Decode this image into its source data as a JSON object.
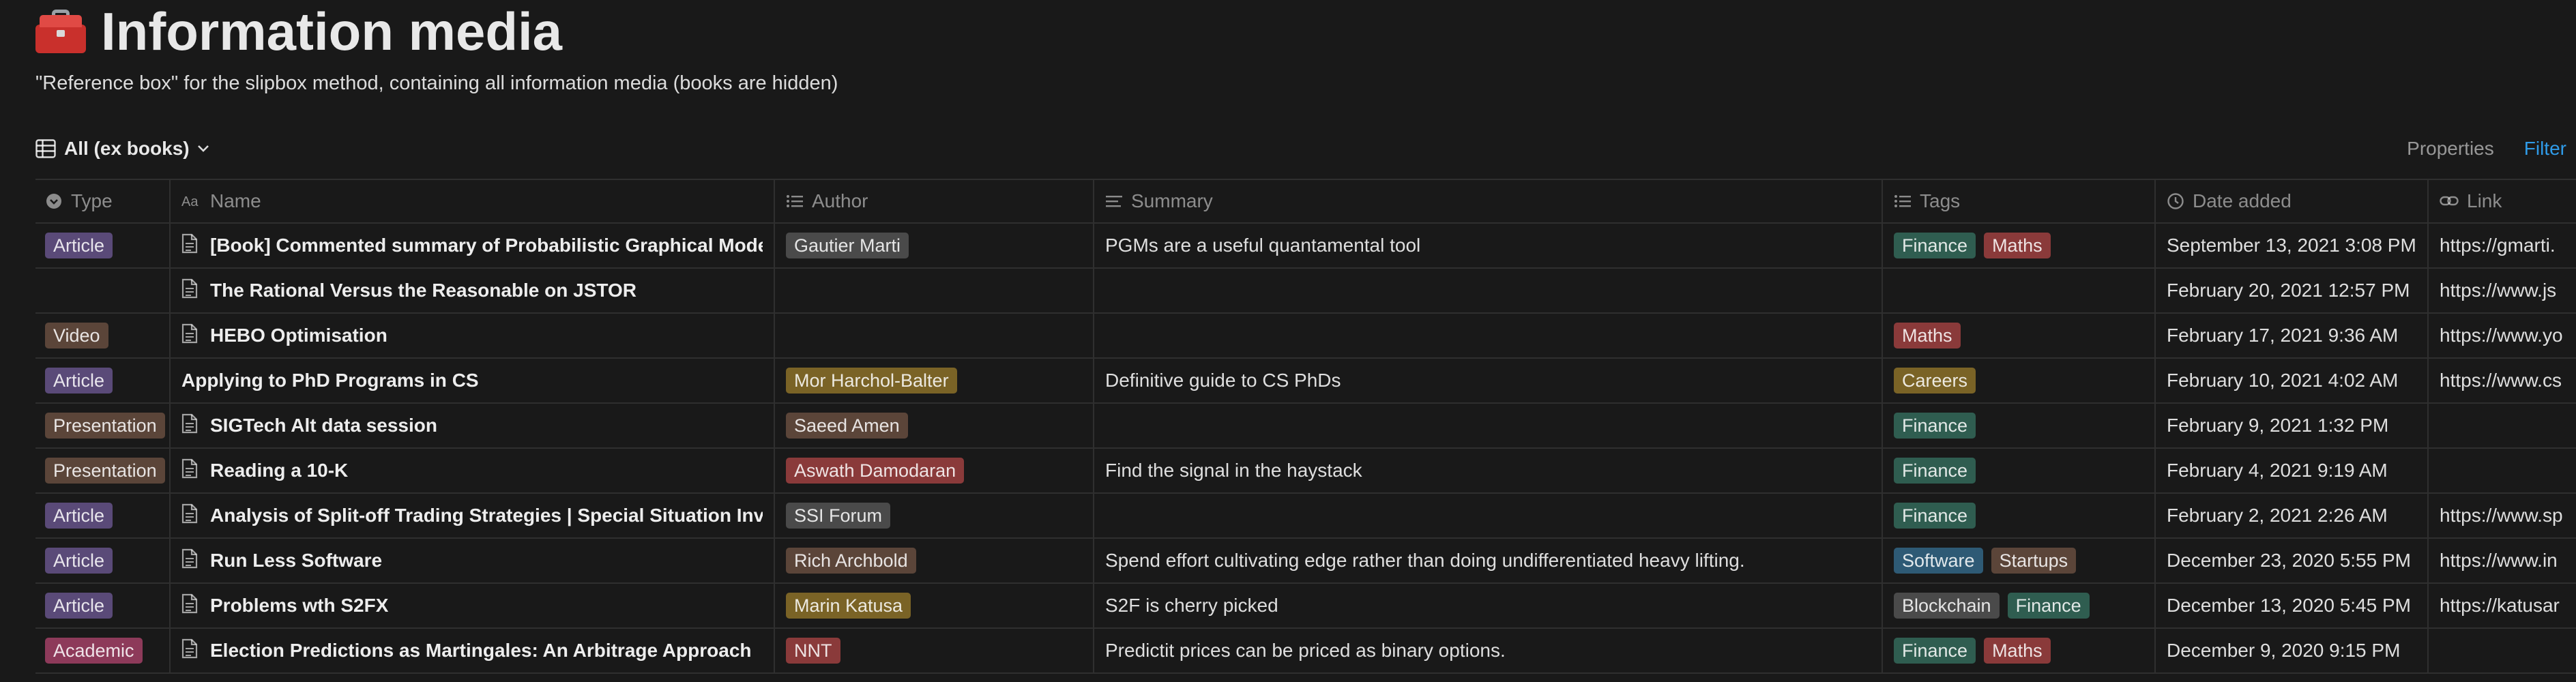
{
  "page": {
    "title": "Information media",
    "icon": "toolbox-icon",
    "description": "\"Reference box\" for the slipbox method, containing all information media (books are hidden)"
  },
  "view": {
    "name": "All (ex books)",
    "icon": "table-icon",
    "properties_label": "Properties",
    "filter_label": "Filter"
  },
  "columns": {
    "type": "Type",
    "name": "Name",
    "author": "Author",
    "summary": "Summary",
    "tags": "Tags",
    "date_added": "Date added",
    "link": "Link"
  },
  "colors": {
    "Article": "#5a4a78",
    "Video": "#5b4539",
    "Presentation": "#5b4539",
    "Academic": "#8d3a5a",
    "Finance": "#2f5d50",
    "Maths": "#8a3a3a",
    "Careers": "#7a6326",
    "Software": "#2e5a75",
    "Startups": "#5b4539",
    "Blockchain": "#4a4a4a",
    "Gautier Marti": "#4a4a4a",
    "Mor Harchol-Balter": "#7a6326",
    "Saeed Amen": "#5b4539",
    "Aswath Damodaran": "#8a3a3a",
    "SSI Forum": "#4a4a4a",
    "Rich Archbold": "#5b4539",
    "Marin Katusa": "#7a6326",
    "NNT": "#8a3a3a"
  },
  "rows": [
    {
      "type": "Article",
      "name": "[Book] Commented summary of Probabilistic Graphical Models",
      "has_doc_icon": true,
      "author": "Gautier Marti",
      "summary": "PGMs are a useful quantamental tool",
      "tags": [
        "Finance",
        "Maths"
      ],
      "date": "September 13, 2021 3:08 PM",
      "link": "https://gmarti."
    },
    {
      "type": "",
      "name": "The Rational Versus the Reasonable on JSTOR",
      "has_doc_icon": true,
      "author": "",
      "summary": "",
      "tags": [],
      "date": "February 20, 2021 12:57 PM",
      "link": "https://www.js"
    },
    {
      "type": "Video",
      "name": "HEBO Optimisation",
      "has_doc_icon": true,
      "author": "",
      "summary": "",
      "tags": [
        "Maths"
      ],
      "date": "February 17, 2021 9:36 AM",
      "link": "https://www.yo"
    },
    {
      "type": "Article",
      "name": "Applying to PhD Programs in CS",
      "has_doc_icon": false,
      "author": "Mor Harchol-Balter",
      "summary": "Definitive guide to CS PhDs",
      "tags": [
        "Careers"
      ],
      "date": "February 10, 2021 4:02 AM",
      "link": "https://www.cs"
    },
    {
      "type": "Presentation",
      "name": "SIGTech Alt data session",
      "has_doc_icon": true,
      "author": "Saeed Amen",
      "summary": "",
      "tags": [
        "Finance"
      ],
      "date": "February 9, 2021 1:32 PM",
      "link": ""
    },
    {
      "type": "Presentation",
      "name": "Reading a 10-K",
      "has_doc_icon": true,
      "author": "Aswath Damodaran",
      "summary": "Find the signal in the haystack",
      "tags": [
        "Finance"
      ],
      "date": "February 4, 2021 9:19 AM",
      "link": ""
    },
    {
      "type": "Article",
      "name": "Analysis of Split-off Trading Strategies | Special Situation Inves",
      "has_doc_icon": true,
      "author": "SSI Forum",
      "summary": "",
      "tags": [
        "Finance"
      ],
      "date": "February 2, 2021 2:26 AM",
      "link": "https://www.sp"
    },
    {
      "type": "Article",
      "name": "Run Less Software",
      "has_doc_icon": true,
      "author": "Rich Archbold",
      "summary": "Spend effort cultivating edge rather than doing undifferentiated heavy lifting.",
      "tags": [
        "Software",
        "Startups"
      ],
      "date": "December 23, 2020 5:55 PM",
      "link": "https://www.in"
    },
    {
      "type": "Article",
      "name": "Problems wth S2FX",
      "has_doc_icon": true,
      "author": "Marin Katusa",
      "summary": "S2F is cherry picked",
      "tags": [
        "Blockchain",
        "Finance"
      ],
      "date": "December 13, 2020 5:45 PM",
      "link": "https://katusar"
    },
    {
      "type": "Academic",
      "name": "Election Predictions as Martingales: An Arbitrage Approach",
      "has_doc_icon": true,
      "author": "NNT",
      "summary": "Predictit prices can be priced as binary options.",
      "tags": [
        "Finance",
        "Maths"
      ],
      "date": "December 9, 2020 9:15 PM",
      "link": ""
    }
  ]
}
